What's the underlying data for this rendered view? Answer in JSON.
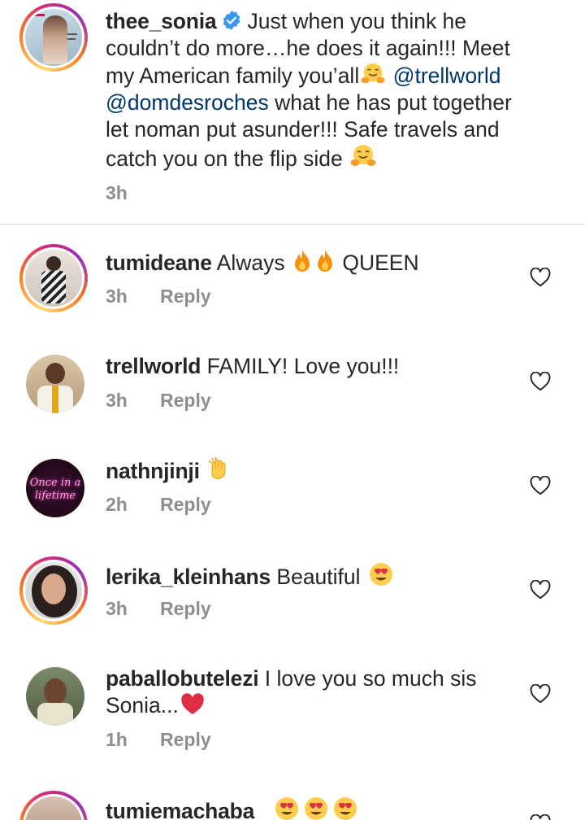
{
  "caption": {
    "username": "thee_sonia",
    "text_1": "Just when you think he couldn’t do more…he does it again!!! Meet my American family you’all",
    "mention_1": "@trellworld",
    "mention_2": "@domdesroches",
    "text_2": "what he has put together let noman put asunder!!! Safe travels and catch you on the flip side",
    "time": "3h",
    "avatar_icon": "magazine-cover-avatar"
  },
  "comments": [
    {
      "username": "tumideane",
      "text": "Always",
      "text_after": "QUEEN",
      "time": "3h",
      "reply": "Reply",
      "emojis": [
        "fire-emoji",
        "fire-emoji"
      ]
    },
    {
      "username": "trellworld",
      "text": "FAMILY! Love you!!!",
      "time": "3h",
      "reply": "Reply"
    },
    {
      "username": "nathnjinji",
      "text": "",
      "time": "2h",
      "reply": "Reply",
      "emojis": [
        "clapping-hand-emoji"
      ],
      "avatar_text_1": "Once in a",
      "avatar_text_2": "lifetime"
    },
    {
      "username": "lerika_kleinhans",
      "text": "Beautiful",
      "time": "3h",
      "reply": "Reply",
      "emojis": [
        "heart-eyes-emoji"
      ]
    },
    {
      "username": "paballobutelezi",
      "text": "I love you so much sis Sonia...",
      "time": "1h",
      "reply": "Reply",
      "emojis": [
        "red-heart-emoji"
      ]
    },
    {
      "username": "tumiemachaba_",
      "text": "",
      "emojis": [
        "heart-eyes-emoji",
        "heart-eyes-emoji",
        "heart-eyes-emoji"
      ]
    }
  ],
  "colors": {
    "mention": "#00376b",
    "meta": "#8e8e8e",
    "verified": "#3897f0",
    "divider": "#dbdbdb"
  }
}
